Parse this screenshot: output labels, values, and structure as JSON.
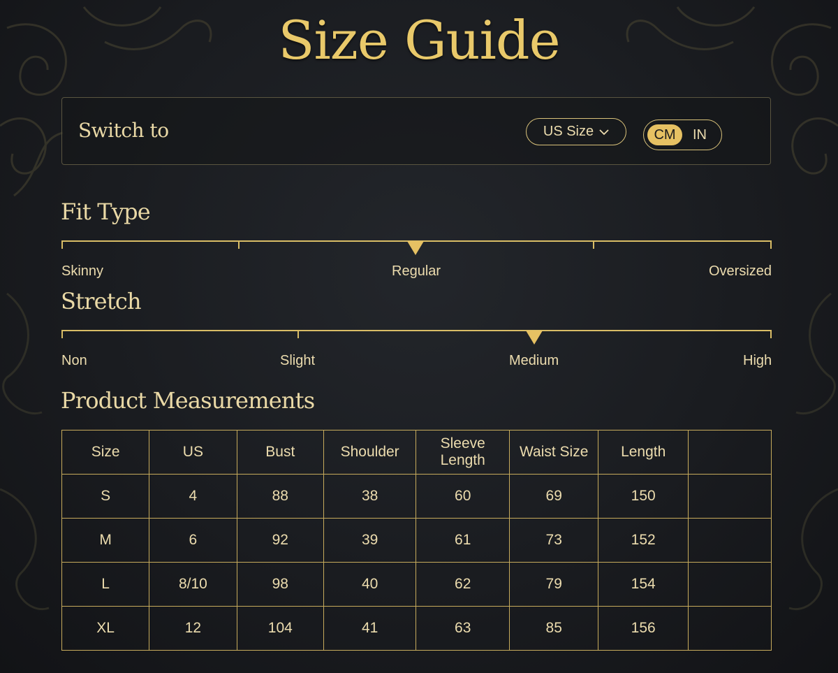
{
  "title": "Size Guide",
  "switch": {
    "label": "Switch to",
    "size_system": "US Size",
    "units": [
      "CM",
      "IN"
    ],
    "active_unit": "CM"
  },
  "fit_type": {
    "heading": "Fit Type",
    "labels": [
      "Skinny",
      "Regular",
      "Oversized"
    ],
    "selected": "Regular"
  },
  "stretch": {
    "heading": "Stretch",
    "labels": [
      "Non",
      "Slight",
      "Medium",
      "High"
    ],
    "selected": "Medium"
  },
  "measurements": {
    "heading": "Product Measurements",
    "columns": [
      "Size",
      "US",
      "Bust",
      "Shoulder",
      "Sleeve Length",
      "Waist Size",
      "Length"
    ],
    "rows": [
      [
        "S",
        "4",
        "88",
        "38",
        "60",
        "69",
        "150"
      ],
      [
        "M",
        "6",
        "92",
        "39",
        "61",
        "73",
        "152"
      ],
      [
        "L",
        "8/10",
        "98",
        "40",
        "62",
        "79",
        "154"
      ],
      [
        "XL",
        "12",
        "104",
        "41",
        "63",
        "85",
        "156"
      ]
    ]
  },
  "colors": {
    "accent": "#e6c163",
    "background": "#1a1c20",
    "text": "#ecdcae"
  },
  "icons": {
    "dropdown": "chevron-down-icon",
    "scale_marker": "triangle-marker-icon",
    "ornament": "filigree-ornament-icon"
  }
}
